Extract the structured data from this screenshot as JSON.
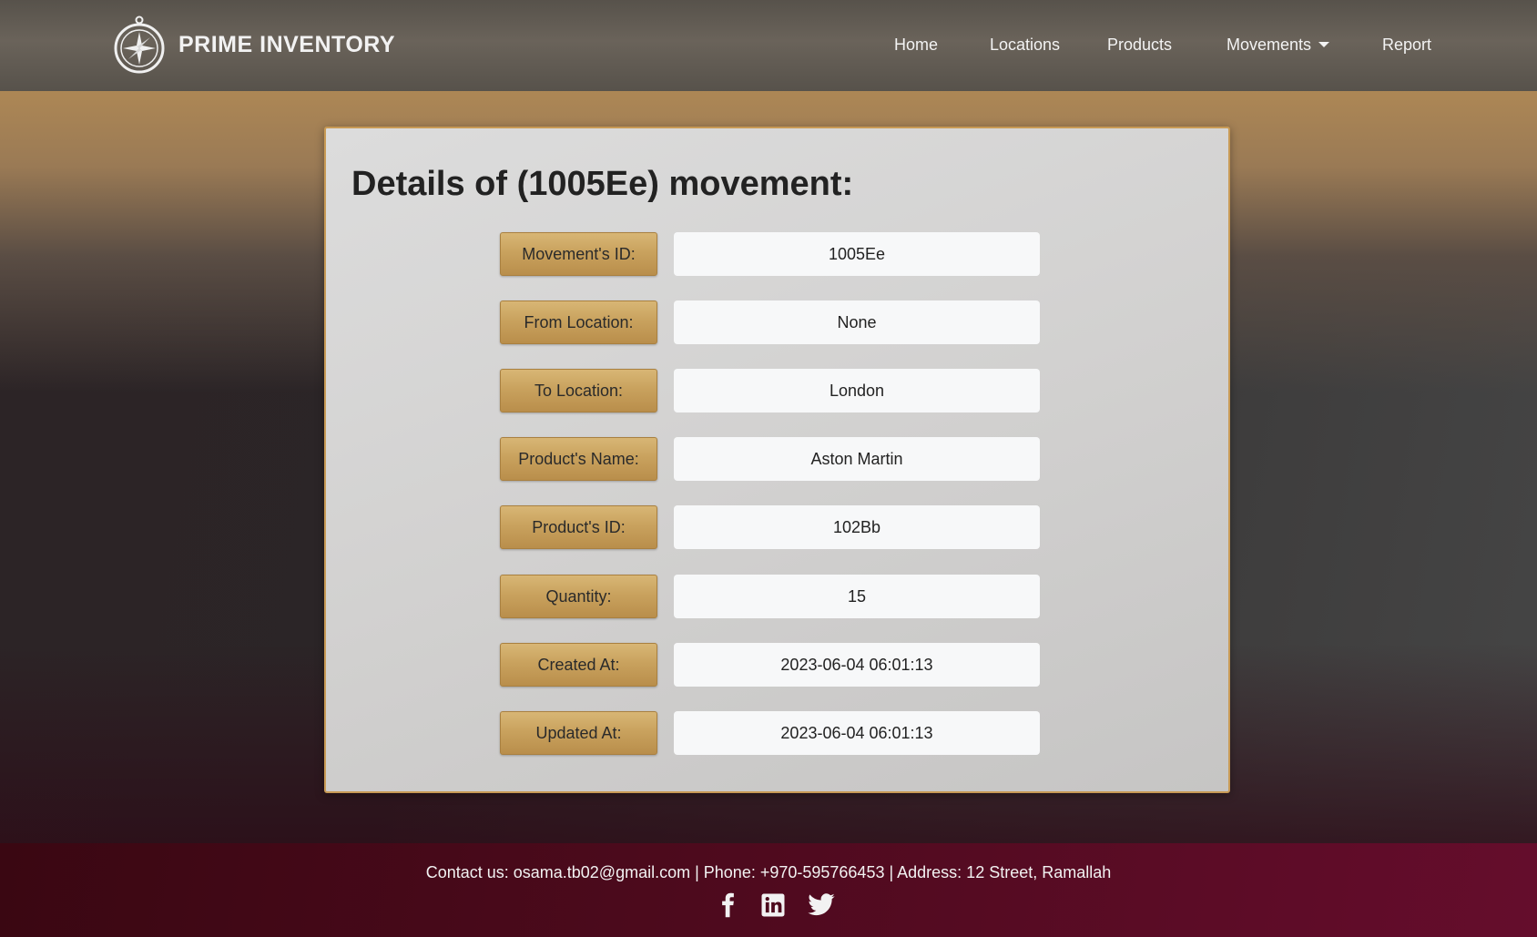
{
  "brand": {
    "name": "PRIME INVENTORY",
    "logo_icon": "compass-icon"
  },
  "nav": {
    "home": "Home",
    "locations": "Locations",
    "products": "Products",
    "movements": "Movements",
    "report": "Report"
  },
  "page": {
    "title": "Details of (1005Ee) movement:"
  },
  "details": [
    {
      "label": "Movement's ID:",
      "value": "1005Ee"
    },
    {
      "label": "From Location:",
      "value": "None"
    },
    {
      "label": "To Location:",
      "value": "London"
    },
    {
      "label": "Product's Name:",
      "value": "Aston Martin"
    },
    {
      "label": "Product's ID:",
      "value": "102Bb"
    },
    {
      "label": "Quantity:",
      "value": "15"
    },
    {
      "label": "Created At:",
      "value": "2023-06-04 06:01:13"
    },
    {
      "label": "Updated At:",
      "value": "2023-06-04 06:01:13"
    }
  ],
  "footer": {
    "contact": "Contact us: osama.tb02@gmail.com | Phone: +970-595766453 | Address: 12 Street, Ramallah",
    "social": [
      "facebook-icon",
      "linkedin-icon",
      "twitter-icon"
    ]
  },
  "colors": {
    "label_gold": "#c9a25e",
    "card_border": "#c89a55",
    "navbar": "#5f5951",
    "footer": "#4d0a1d"
  }
}
